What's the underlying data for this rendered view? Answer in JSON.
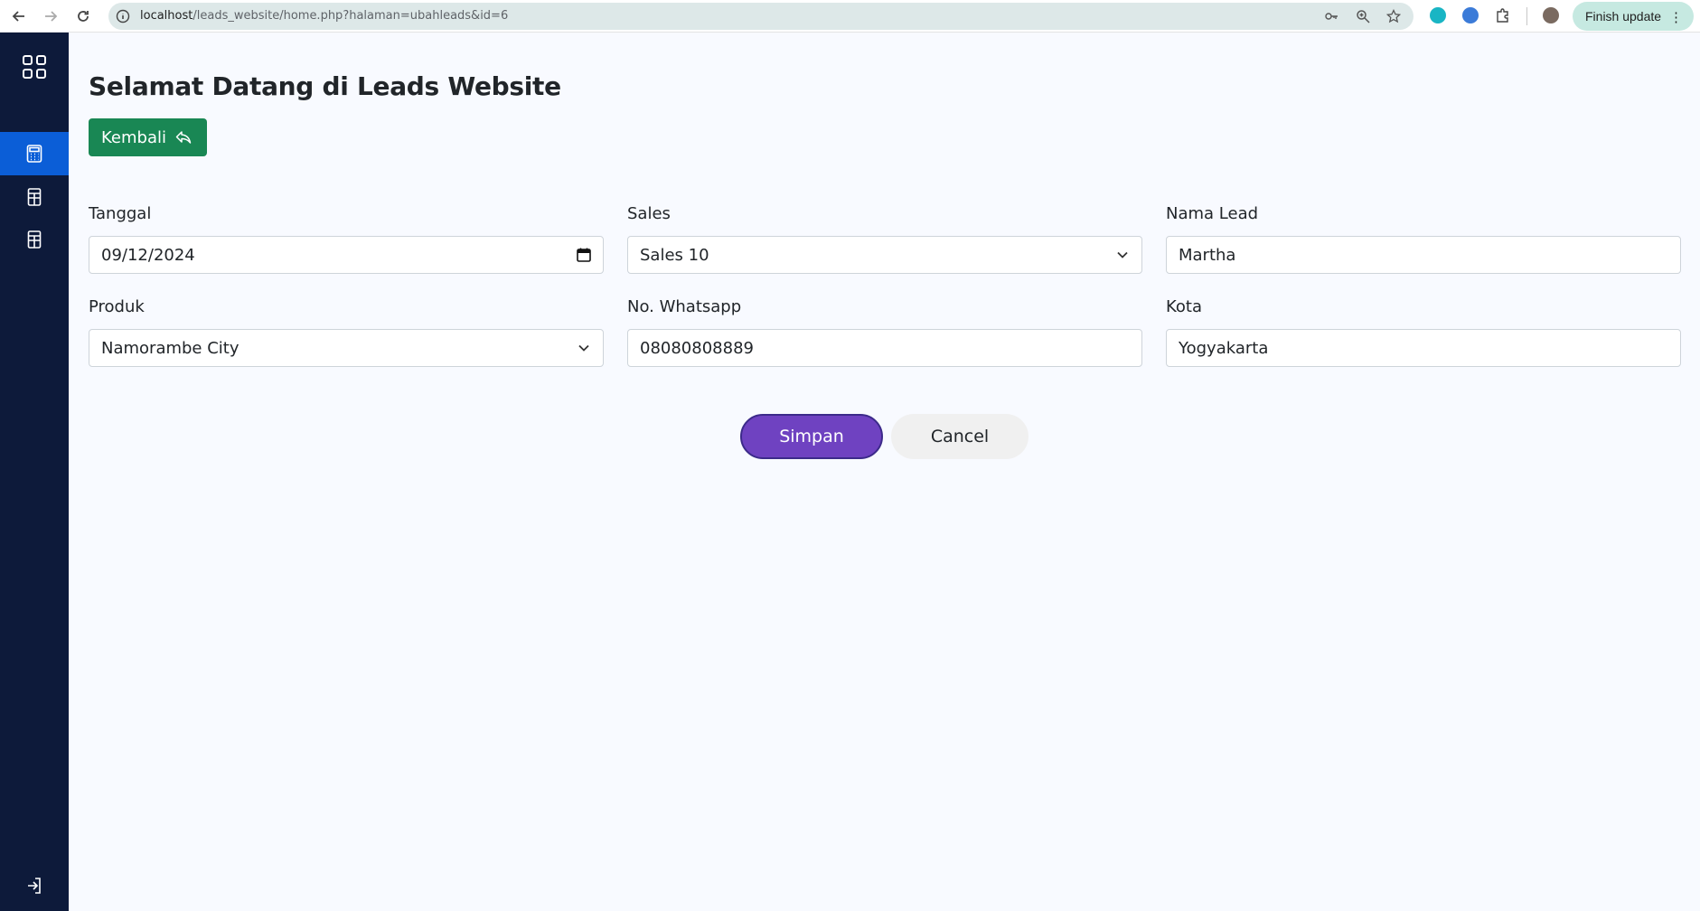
{
  "browser": {
    "url_host": "localhost",
    "url_path": "/leads_website/home.php?halaman=ubahleads&id=6",
    "update_label": "Finish update"
  },
  "page": {
    "title": "Selamat Datang di Leads Website",
    "back_label": "Kembali"
  },
  "form": {
    "tanggal": {
      "label": "Tanggal",
      "value": "09/12/2024"
    },
    "sales": {
      "label": "Sales",
      "value": "Sales 10"
    },
    "nama_lead": {
      "label": "Nama Lead",
      "value": "Martha"
    },
    "produk": {
      "label": "Produk",
      "value": "Namorambe City"
    },
    "whatsapp": {
      "label": "No. Whatsapp",
      "value": "08080808889"
    },
    "kota": {
      "label": "Kota",
      "value": "Yogyakarta"
    }
  },
  "actions": {
    "save_label": "Simpan",
    "cancel_label": "Cancel"
  },
  "colors": {
    "sidebar": "#0d1a3a",
    "sidebar_active": "#0b5ed7",
    "back_button": "#198754",
    "save_button": "#6f42c1"
  },
  "icons": {
    "sidebar": [
      "grid-icon",
      "calculator-icon",
      "building-icon",
      "building-icon",
      "logout-icon"
    ]
  }
}
